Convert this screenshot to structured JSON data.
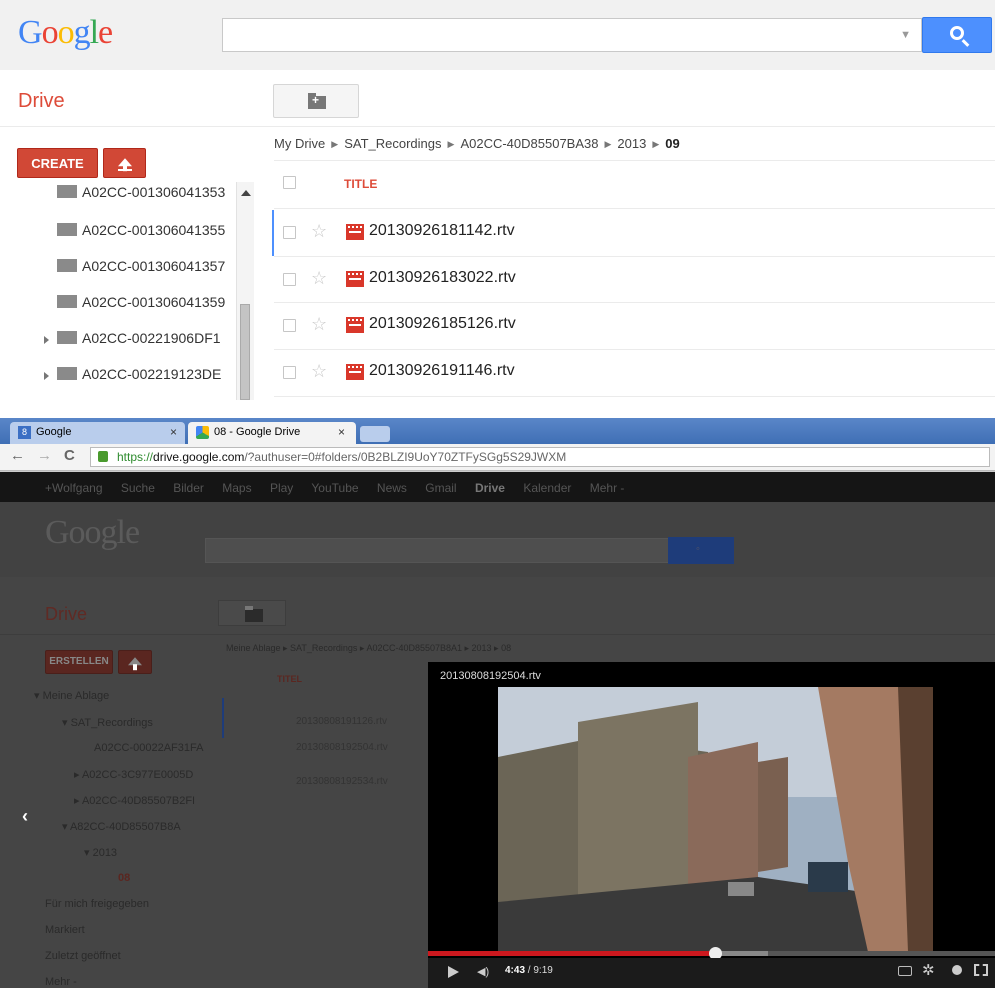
{
  "top": {
    "logo": "Google",
    "drive_title": "Drive",
    "create_label": "CREATE",
    "tree_items": [
      "A02CC-001306041353",
      "A02CC-001306041355",
      "A02CC-001306041357",
      "A02CC-001306041359",
      "A02CC-00221906DF1",
      "A02CC-002219123DE"
    ],
    "breadcrumb": [
      "My Drive",
      "SAT_Recordings",
      "A02CC-40D85507BA38",
      "2013",
      "09"
    ],
    "title_header": "TITLE",
    "files": [
      "20130926181142.rtv",
      "20130926183022.rtv",
      "20130926185126.rtv",
      "20130926191146.rtv"
    ]
  },
  "browser": {
    "tabs": [
      "Google",
      "08 - Google Drive"
    ],
    "url_https": "https://",
    "url_host": "drive.google.com",
    "url_path": "/?authuser=0#folders/0B2BLZI9UoY70ZTFySGg5S29JWXM",
    "gbar_items": [
      "+Wolfgang",
      "Suche",
      "Bilder",
      "Maps",
      "Play",
      "YouTube",
      "News",
      "Gmail",
      "Drive",
      "Kalender",
      "Mehr -"
    ],
    "logo": "Google",
    "drive_title": "Drive",
    "create_label": "ERSTELLEN",
    "breadcrumb": "Meine Ablage  ▸  SAT_Recordings  ▸  A02CC-40D85507B8A1  ▸  2013  ▸  08",
    "title_header": "TITEL",
    "tree": [
      "▾ Meine Ablage",
      "▾ SAT_Recordings",
      "A02CC-00022AF31FA",
      "▸ A02CC-3C977E0005D",
      "▸ A02CC-40D85507B2FI",
      "▾ A82CC-40D85507B8A",
      "▾ 2013",
      "08"
    ],
    "tree_bottom": [
      "Für mich freigegeben",
      "Markiert",
      "Zuletzt geöffnet",
      "Mehr -"
    ],
    "files": [
      "20130808191126.rtv",
      "20130808192504.rtv",
      "20130808192534.rtv"
    ],
    "player": {
      "title": "20130808192504.rtv",
      "current_time": "4:43",
      "duration": "/ 9:19",
      "progress_fraction": 0.506
    }
  },
  "colors": {
    "accent_red": "#dd4b39",
    "create_red": "#d14836",
    "search_blue": "#4d90fe"
  }
}
